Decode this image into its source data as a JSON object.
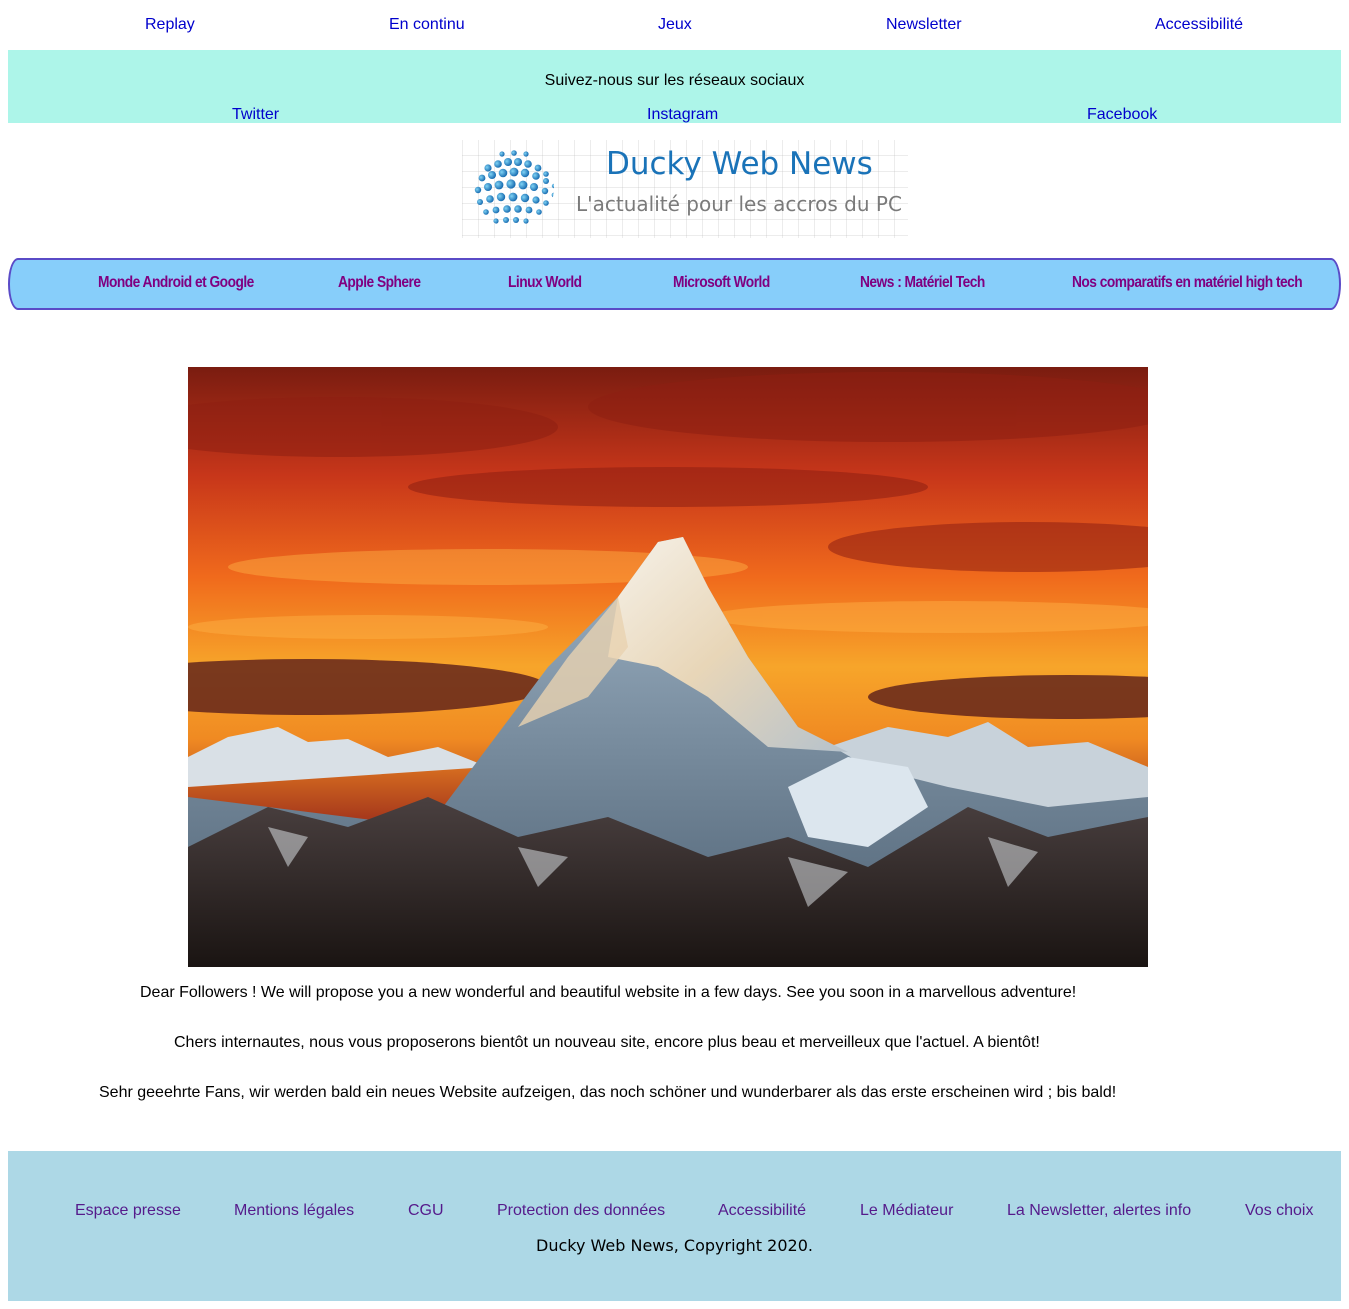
{
  "top_nav": [
    "Replay",
    "En continu",
    "Jeux",
    "Newsletter",
    "Accessibilité"
  ],
  "social": {
    "title": "Suivez-nous sur les réseaux sociaux",
    "links": [
      "Twitter",
      "Instagram",
      "Facebook"
    ]
  },
  "logo": {
    "brand": "Ducky Web News",
    "tagline": "L'actualité pour les accros du PC",
    "icon": "globe-icon",
    "colors": {
      "brand": "#1a73b8",
      "tagline": "#7a7a7a"
    }
  },
  "categories": [
    "Monde Android et Google",
    "Apple Sphere",
    "Linux World",
    "Microsoft World",
    "News : Matériel Tech",
    "Nos comparatifs en matériel high tech"
  ],
  "hero": {
    "subject": "snow-capped mountain peak at sunset"
  },
  "messages": {
    "en": "Dear Followers ! We will propose you a new wonderful and beautiful website in a few days. See you soon in a marvellous adventure!",
    "fr": "Chers internautes, nous vous proposerons bientôt un nouveau site, encore plus beau et merveilleux que l'actuel. A bientôt!",
    "de": "Sehr geeehrte Fans, wir werden bald ein neues Website aufzeigen, das noch schöner und wunderbarer als das erste erscheinen wird ; bis bald!"
  },
  "footer": {
    "links": [
      "Espace presse",
      "Mentions légales",
      "CGU",
      "Protection des données",
      "Accessibilité",
      "Le Médiateur",
      "La Newsletter, alertes info",
      "Vos choix"
    ],
    "copyright": "Ducky Web News, Copyright 2020."
  },
  "colors": {
    "social_band": "#adf5e9",
    "category_menu": "#87cefa",
    "category_text": "#800080",
    "footer_bg": "#add8e6",
    "link": "#0000cc"
  }
}
